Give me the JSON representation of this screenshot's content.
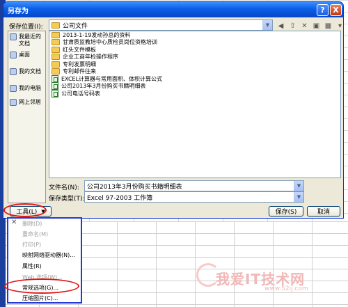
{
  "dialog": {
    "title": "另存为",
    "help_label": "?",
    "close_label": "X",
    "save_in_label": "保存位置(I):",
    "save_in_value": "公司文件",
    "places": [
      {
        "label": "我最近的文档"
      },
      {
        "label": "桌面"
      },
      {
        "label": "我的文档"
      },
      {
        "label": "我的电脑"
      },
      {
        "label": "网上邻居"
      }
    ],
    "files": [
      {
        "name": "2013-1-19发动孙总的资料",
        "type": "folder"
      },
      {
        "name": "甘肃质监教培中心质检员岗位资格培训",
        "type": "folder"
      },
      {
        "name": "红头文件模板",
        "type": "folder"
      },
      {
        "name": "企业工商年检操作程序",
        "type": "folder"
      },
      {
        "name": "专利发票明细",
        "type": "folder"
      },
      {
        "name": "专利邮件往来",
        "type": "folder"
      },
      {
        "name": "EXCEL计算器与常用面积、体积计算公式",
        "type": "xls"
      },
      {
        "name": "公司2013年3月份购买书籍明细表",
        "type": "xls"
      },
      {
        "name": "公司电话号码表",
        "type": "xls"
      }
    ],
    "filename_label": "文件名(N):",
    "filename_value": "公司2013年3月份购买书籍明细表",
    "filetype_label": "保存类型(T):",
    "filetype_value": "Excel 97-2003 工作簿",
    "tools_label": "工具(L)",
    "save_label": "保存(S)",
    "cancel_label": "取消"
  },
  "tools_menu": {
    "items": [
      {
        "label": "删除(D)",
        "enabled": false
      },
      {
        "label": "重命名(M)",
        "enabled": false
      },
      {
        "label": "打印(P)",
        "enabled": false
      },
      {
        "label": "映射网络驱动器(N)...",
        "enabled": true
      },
      {
        "label": "属性(R)",
        "enabled": true
      },
      {
        "label": "Web 选项(W)...",
        "enabled": false
      },
      {
        "label": "常规选项(G)...",
        "enabled": true
      },
      {
        "label": "压缩图片(C)...",
        "enabled": true
      }
    ]
  },
  "watermark": {
    "text": "我爱IT技术网",
    "url": "www.52ij.com"
  }
}
